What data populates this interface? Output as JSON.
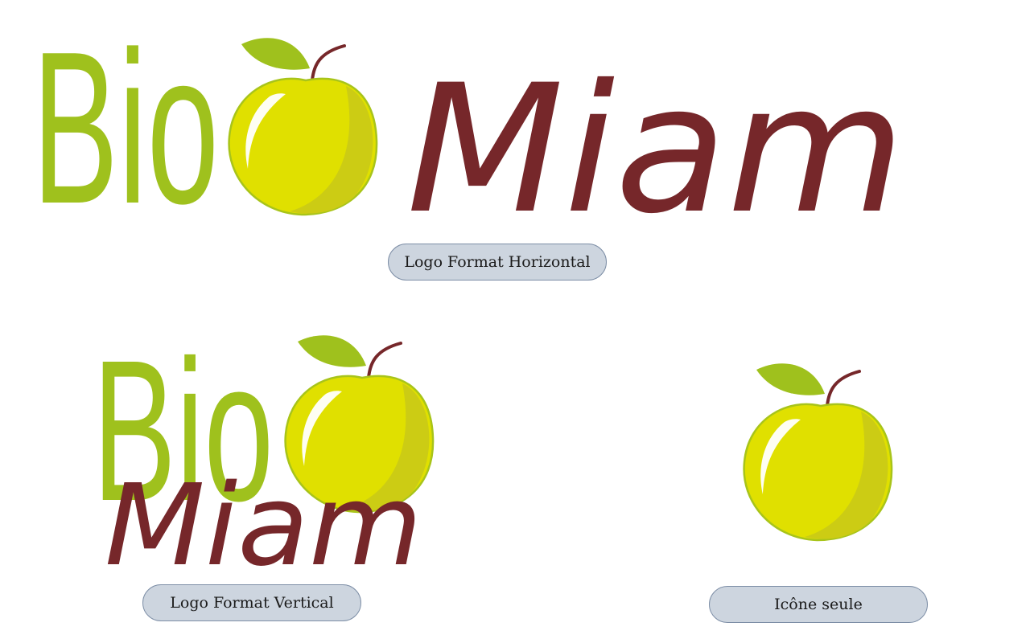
{
  "colors": {
    "bio_green": "#9fc11d",
    "apple_yellow": "#e0e000",
    "apple_shade": "#cccc14",
    "apple_outline": "#a8c41a",
    "leaf_green": "#9fc11d",
    "stem_brown": "#76272a",
    "miam_brown": "#76272a",
    "caption_bg": "#cdd5df",
    "caption_border": "#7d8ea6"
  },
  "logo": {
    "word_bio": "Bio",
    "word_miam": "Miam"
  },
  "captions": {
    "horizontal": "Logo Format Horizontal",
    "vertical": "Logo Format Vertical",
    "icon": "Icône seule"
  }
}
